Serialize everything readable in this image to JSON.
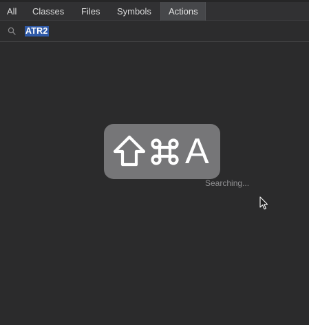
{
  "tabs": [
    {
      "label": "All",
      "active": false
    },
    {
      "label": "Classes",
      "active": false
    },
    {
      "label": "Files",
      "active": false
    },
    {
      "label": "Symbols",
      "active": false
    },
    {
      "label": "Actions",
      "active": true
    }
  ],
  "search": {
    "value": "ATR2",
    "icon": "search-icon"
  },
  "shortcut_hud": {
    "keys": [
      "shift",
      "command",
      "A"
    ],
    "letter": "A"
  },
  "status_text": "Searching...",
  "colors": {
    "background": "#2b2b2c",
    "selection": "#2f5aa8",
    "hud": "#7d7d7f"
  }
}
